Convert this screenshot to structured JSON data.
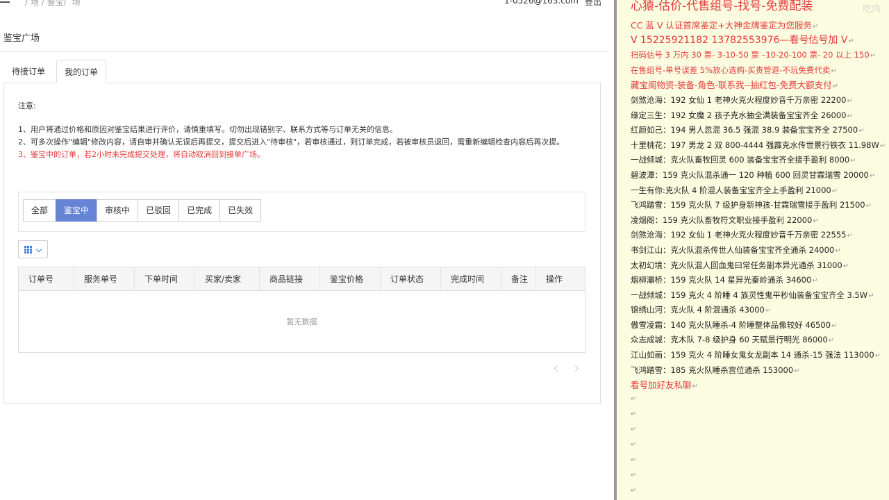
{
  "topbar": {
    "breadcrumb": "/ 场 / 鉴宝广场",
    "email": "1-0526@163.com",
    "logout": "登出"
  },
  "page_title": "鉴宝广场",
  "tabs": [
    {
      "label": "待接订单"
    },
    {
      "label": "我的订单"
    }
  ],
  "notice": {
    "title": "注意:",
    "items": [
      "1、用户将通过价格和原因对鉴宝结果进行评价，请慎重填写。切勿出现错别字、联系方式等与订单无关的信息。",
      "2、可多次操作\"编辑\"修改内容，请自审并确认无误后再提交，提交后进入\"待审核\"，若审核通过，则订单完成，若被审核员退回，需重新编辑检查内容后再次提。",
      "3、鉴宝中的订单，若2小时未完成提交处理，将自动取消回到接单广场。"
    ]
  },
  "filters": [
    "全部",
    "鉴宝中",
    "审核中",
    "已驳回",
    "已完成",
    "已失效"
  ],
  "active_filter": "鉴宝中",
  "table": {
    "columns": [
      "订单号",
      "服务单号",
      "下单时间",
      "买家/卖家",
      "商品链接",
      "鉴宝价格",
      "订单状态",
      "完成时间",
      "备注",
      "操作"
    ],
    "empty_text": "暂无数据"
  },
  "overlay": {
    "watermark": "吃鸡",
    "title": "心猿-估价-代售组号-找号-免费配装",
    "lines": [
      {
        "text": "CC 蓝 V 认证首席鉴定+大神金牌鉴定为您服务",
        "style": "red rmid"
      },
      {
        "text": "V 15225921182     13782553976—看号估号加 V",
        "style": "red big"
      },
      {
        "text": "扫码估号 3 万内 30 票- 3-10-50 票  –10-20-100 票- 20 以上 150",
        "style": "red"
      },
      {
        "text": "在售组号-单号误差 5%放心选购-买贵管退-不玩免费代卖",
        "style": "red"
      },
      {
        "text": "藏宝阁物资-装备-角色-联系我--抽红包-免费大额支付",
        "style": "red rmid"
      },
      {
        "text": "剑煞沧海：192 女仙 1 老神火克火程度妙音千万亲密 22200",
        "style": ""
      },
      {
        "text": "缘定三生：192 女魔 2 孩子克水抽全满装备宝宝齐全 26000",
        "style": ""
      },
      {
        "text": "红颜如己：194 男人忽混 36.5 强混 38.9 装备宝宝齐全 27500",
        "style": ""
      },
      {
        "text": "十里桃花：197 男龙 2 双 800-4444 强霹克水传世景行铁衣 11.98W",
        "style": ""
      },
      {
        "text": "一战倾城：克火队畜牧回灵 600 装备宝宝齐全接手盈利 8000",
        "style": ""
      },
      {
        "text": "碧波潭：159 克火队混杀通一 120 种植 600 回灵甘霖瑞雪 20000",
        "style": ""
      },
      {
        "text": "一生有你:克火队 4 阶混人装备宝宝齐全上手盈利 21000",
        "style": ""
      },
      {
        "text": "飞鸿踏雪：159 克火队 7 级护身新神孩-甘霖瑞雪接手盈利 21500",
        "style": ""
      },
      {
        "text": "凌烟阁：159 克火队畜牧符文职业接手盈利 22000",
        "style": ""
      },
      {
        "text": "剑煞沧海：192 女仙 1 老神火克火程度妙音千万亲密 22555",
        "style": ""
      },
      {
        "text": "书剑江山：克火队混杀传世人仙装备宝宝齐全通杀 24000",
        "style": ""
      },
      {
        "text": "太初幻境：克火队混人回血鬼曰常任务副本异光通杀 31000",
        "style": ""
      },
      {
        "text": "烟柳灞桥：159 克火队 14 星异光秦岭通杀 34600",
        "style": ""
      },
      {
        "text": "一战倾城：159 克火 4 阶睡 4 族灵性鬼平秒仙装备宝宝齐全 3.5W",
        "style": ""
      },
      {
        "text": "锦绣山河：克火队 4 阶混通杀 43000",
        "style": ""
      },
      {
        "text": "傲雪凌霜：140 克火队睡杀-4 阶睡整体品像较好 46500",
        "style": ""
      },
      {
        "text": "众志成城：克木队 7-8 级护身 60 天赋景行明光 86000",
        "style": ""
      },
      {
        "text": "江山如画：159 克火 4 阶睡女鬼女龙副本 14 通杀-15 强法 113000",
        "style": ""
      },
      {
        "text": "飞鸿踏雪：185 克火队睡杀宫位通杀 153000",
        "style": ""
      },
      {
        "text": "看号加好友私聊",
        "style": "red rmid"
      }
    ]
  }
}
